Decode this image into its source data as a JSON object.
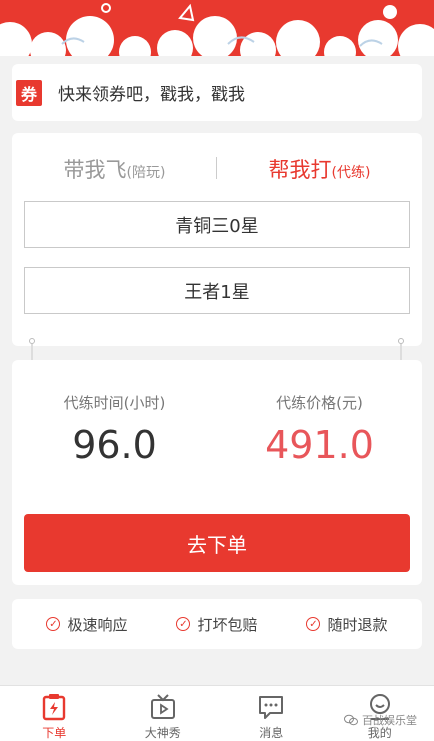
{
  "coupon": {
    "tag": "券",
    "text": "快来领券吧，戳我，戳我"
  },
  "mode_tabs": [
    {
      "label": "带我飞",
      "sub": "(陪玩)"
    },
    {
      "label": "帮我打",
      "sub": "(代练)"
    }
  ],
  "rank": {
    "current": "青铜三0星",
    "target": "王者1星"
  },
  "pricing": {
    "time_label": "代练时间(小时)",
    "time_value": "96.0",
    "price_label": "代练价格(元)",
    "price_value": "491.0"
  },
  "order_button": "去下单",
  "guarantees": [
    "极速响应",
    "打坏包赔",
    "随时退款"
  ],
  "tabbar": [
    "下单",
    "大神秀",
    "消息",
    "我的"
  ],
  "watermark": "百战娱乐堂",
  "colors": {
    "accent": "#e8392f",
    "price_red": "#e8565a"
  }
}
